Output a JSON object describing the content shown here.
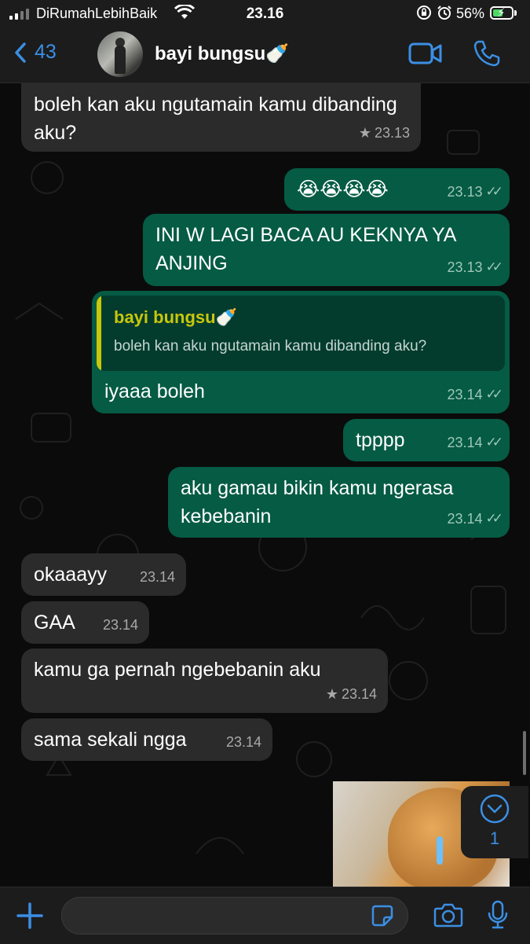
{
  "status_bar": {
    "carrier": "DiRumahLebihBaik",
    "time": "23.16",
    "battery_percent": "56%",
    "battery_level": 0.56
  },
  "header": {
    "back_count": "43",
    "contact_name": "bayi bungsu🍼"
  },
  "messages": [
    {
      "direction": "in",
      "text": "boleh kan aku ngutamain kamu dibanding aku?",
      "time": "23.13",
      "starred": true
    },
    {
      "direction": "out",
      "text": "😭😭😭😭",
      "time": "23.13"
    },
    {
      "direction": "out",
      "text": "INI W LAGI BACA AU KEKNYA YA ANJING",
      "time": "23.13"
    },
    {
      "direction": "out",
      "reply_to": {
        "name": "bayi bungsu🍼",
        "text": "boleh kan aku ngutamain kamu dibanding aku?"
      },
      "text": "iyaaa boleh",
      "time": "23.14"
    },
    {
      "direction": "out",
      "text": "tpppp",
      "time": "23.14"
    },
    {
      "direction": "out",
      "text": "aku gamau bikin kamu ngerasa kebebanin",
      "time": "23.14"
    },
    {
      "direction": "in",
      "text": "okaaayy",
      "time": "23.14"
    },
    {
      "direction": "in",
      "text": "GAA",
      "time": "23.14"
    },
    {
      "direction": "in",
      "text": "kamu ga pernah ngebebanin aku",
      "time": "23.14",
      "starred": true
    },
    {
      "direction": "in",
      "text": "sama sekali ngga",
      "time": "23.14"
    }
  ],
  "unread_below": "1",
  "composer": {
    "value": ""
  },
  "icons": {
    "back": "chevron-left-icon",
    "video": "video-camera-icon",
    "phone": "phone-icon",
    "plus": "plus-icon",
    "sticker": "sticker-icon",
    "camera": "camera-icon",
    "mic": "microphone-icon",
    "scroll": "chevron-down-icon"
  },
  "colors": {
    "accent": "#3b8fe4",
    "outgoing_bubble": "#055b44",
    "incoming_bubble": "#2b2b2b",
    "quote_name": "#c9c70b"
  }
}
